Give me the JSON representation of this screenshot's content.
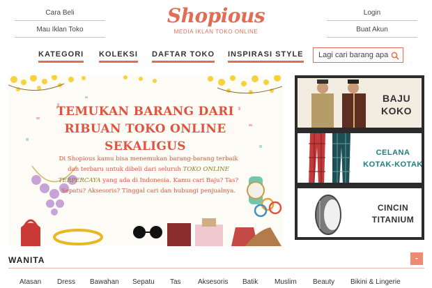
{
  "header": {
    "links_left": [
      "Cara Beli",
      "Mau Iklan Toko"
    ],
    "links_right": [
      "Login",
      "Buat Akun"
    ],
    "logo": "Shopious",
    "tagline": "MEDIA IKLAN TOKO ONLINE"
  },
  "nav": {
    "items": [
      "KATEGORI",
      "KOLEKSI",
      "DAFTAR TOKO",
      "INSPIRASI STYLE"
    ],
    "search_placeholder": "Lagi cari barang apa?"
  },
  "hero": {
    "title_lines": [
      "TEMUKAN BARANG DARI",
      "RIBUAN TOKO ONLINE",
      "SEKALIGUS"
    ],
    "desc_1": "Di Shopious kamu bisa menemukan barang-barang terbaik dan terbaru untuk dibeli dari seluruh",
    "desc_highlight": "TOKO ONLINE TERPERCAYA",
    "desc_2": "yang ada di Indonesia. Kamu cari Baju? Tas? Sepatu? Aksesoris? Tinggal cari dan hubungi penjualnya."
  },
  "promos": [
    {
      "line1": "BAJU",
      "line2": "KOKO",
      "color": "#333333"
    },
    {
      "line1": "CELANA",
      "line2": "KOTAK-KOTAK",
      "color": "#1f7d80"
    },
    {
      "line1": "CINCIN",
      "line2": "TITANIUM",
      "color": "#333333"
    }
  ],
  "section": {
    "title": "WANITA",
    "toggle": "-"
  },
  "categories": [
    "Atasan",
    "Dress",
    "Bawahan",
    "Sepatu",
    "Tas",
    "Aksesoris",
    "Batik",
    "Muslim",
    "Beauty",
    "Bikini & Lingerie"
  ],
  "colors": {
    "accent": "#e36d52",
    "hero_text": "#e0533f",
    "teal": "#1f7d80"
  }
}
